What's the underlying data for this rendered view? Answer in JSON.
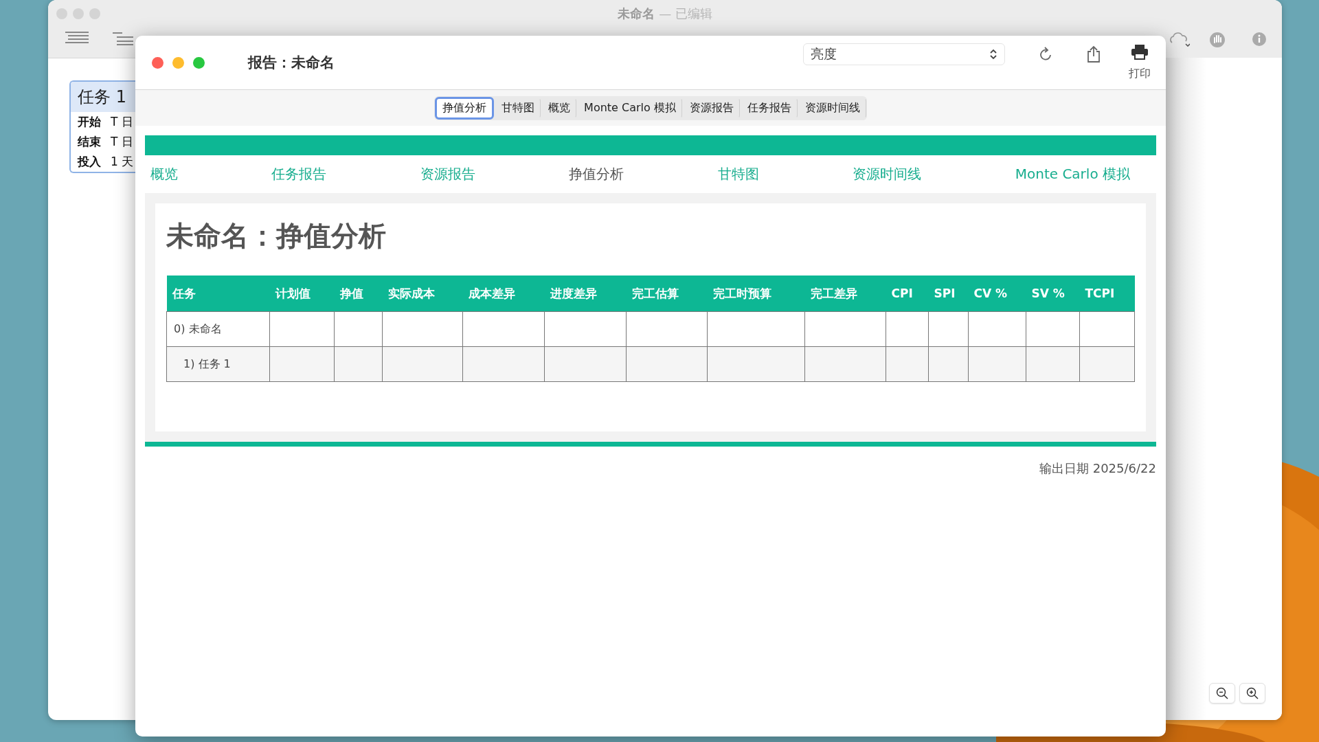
{
  "back_window": {
    "title": "未命名",
    "title_suffix": "— 已编辑",
    "task_card": {
      "title": "任务 1",
      "rows": [
        {
          "label": "开始",
          "value": "T 日"
        },
        {
          "label": "结束",
          "value": "T 日"
        },
        {
          "label": "投入",
          "value": "1 天"
        }
      ]
    }
  },
  "report_window": {
    "title": "报告：未命名",
    "style_select": {
      "value": "亮度"
    },
    "print_label": "打印",
    "report_tabs": [
      {
        "label": "挣值分析",
        "selected": true
      },
      {
        "label": "甘特图",
        "selected": false
      },
      {
        "label": "概览",
        "selected": false
      },
      {
        "label": "Monte Carlo 模拟",
        "selected": false
      },
      {
        "label": "资源报告",
        "selected": false
      },
      {
        "label": "任务报告",
        "selected": false
      },
      {
        "label": "资源时间线",
        "selected": false
      }
    ],
    "nav_links": [
      {
        "label": "概览",
        "selected": false
      },
      {
        "label": "任务报告",
        "selected": false
      },
      {
        "label": "资源报告",
        "selected": false
      },
      {
        "label": "挣值分析",
        "selected": true
      },
      {
        "label": "甘特图",
        "selected": false
      },
      {
        "label": "资源时间线",
        "selected": false
      },
      {
        "label": "Monte Carlo 模拟",
        "selected": false
      }
    ],
    "heading": "未命名：挣值分析",
    "table": {
      "columns": [
        "任务",
        "计划值",
        "挣值",
        "实际成本",
        "成本差异",
        "进度差异",
        "完工估算",
        "完工时预算",
        "完工差异",
        "CPI",
        "SPI",
        "CV %",
        "SV %",
        "TCPI"
      ],
      "rows": [
        {
          "name": "0) 未命名",
          "children": [
            {
              "name": "1) 任务 1"
            }
          ]
        }
      ]
    },
    "export_date": "输出日期 2025/6/22"
  }
}
